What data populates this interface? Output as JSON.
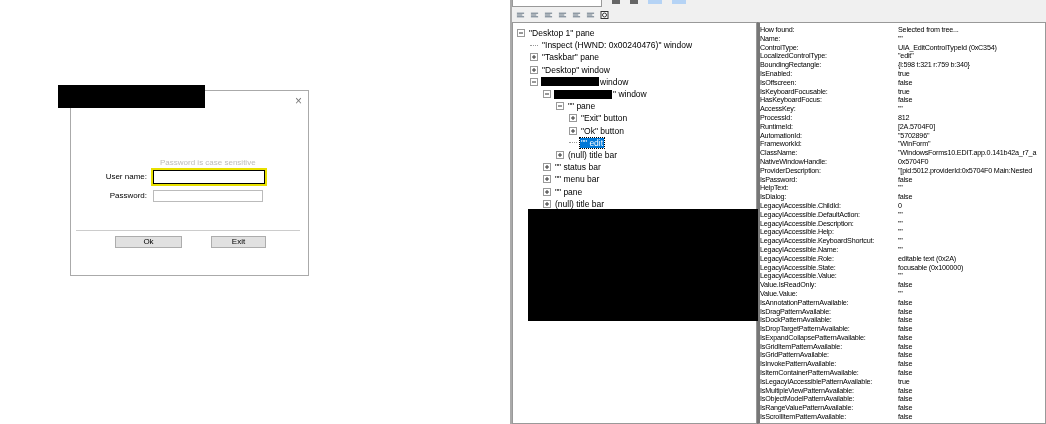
{
  "login_dialog": {
    "title_redacted": true,
    "close": "×",
    "hint": "Password is case sensitive",
    "fields": [
      {
        "label": "User name:",
        "focused": true
      },
      {
        "label": "Password:",
        "focused": false
      }
    ],
    "buttons": [
      "Ok",
      "Exit"
    ]
  },
  "inspect": {
    "tree": {
      "redacted_block": true,
      "items": [
        {
          "label": "\"Desktop 1\" pane",
          "expanded": true,
          "selected": false,
          "children": [
            {
              "label": "\"Inspect  (HWND: 0x00240476)\" window",
              "selected": false
            },
            {
              "label": "\"Taskbar\" pane",
              "expanded": false,
              "selected": false
            },
            {
              "label": "\"Desktop\" window",
              "expanded": false,
              "selected": false
            },
            {
              "label": "window",
              "redacted_prefix": true,
              "expanded": true,
              "selected": false,
              "children": [
                {
                  "label": "\" window",
                  "redacted_prefix": true,
                  "expanded": true,
                  "selected": false,
                  "children": [
                    {
                      "label": "\"\" pane",
                      "expanded": true,
                      "selected": false,
                      "children": [
                        {
                          "label": "\"Exit\" button",
                          "expanded": false,
                          "selected": false
                        },
                        {
                          "label": "\"Ok\" button",
                          "expanded": false,
                          "selected": false
                        },
                        {
                          "label": "\"\" edit",
                          "selected": true
                        }
                      ]
                    },
                    {
                      "label": "(null) title bar",
                      "expanded": false,
                      "selected": false
                    }
                  ]
                },
                {
                  "label": "\"\" status bar",
                  "expanded": false,
                  "selected": false
                },
                {
                  "label": "\"\" menu bar",
                  "expanded": false,
                  "selected": false
                },
                {
                  "label": "\"\" pane",
                  "expanded": false,
                  "selected": false
                },
                {
                  "label": "(null) title bar",
                  "expanded": false,
                  "selected": false
                }
              ]
            }
          ]
        }
      ]
    },
    "properties": [
      {
        "name": "How found:",
        "value": "Selected from tree..."
      },
      {
        "name": "Name:",
        "value": "\"\""
      },
      {
        "name": "ControlType:",
        "value": "UIA_EditControlTypeId (0xC354)"
      },
      {
        "name": "LocalizedControlType:",
        "value": "\"edit\""
      },
      {
        "name": "BoundingRectangle:",
        "value": "{l:598 t:321 r:759 b:340}"
      },
      {
        "name": "IsEnabled:",
        "value": "true"
      },
      {
        "name": "IsOffscreen:",
        "value": "false"
      },
      {
        "name": "IsKeyboardFocusable:",
        "value": "true"
      },
      {
        "name": "HasKeyboardFocus:",
        "value": "false"
      },
      {
        "name": "AccessKey:",
        "value": "\"\""
      },
      {
        "name": "ProcessId:",
        "value": "812"
      },
      {
        "name": "RuntimeId:",
        "value": "[2A.5704F0]"
      },
      {
        "name": "AutomationId:",
        "value": "\"5702896\""
      },
      {
        "name": "FrameworkId:",
        "value": "\"WinForm\""
      },
      {
        "name": "ClassName:",
        "value": "\"WindowsForms10.EDIT.app.0.141b42a_r7_a"
      },
      {
        "name": "NativeWindowHandle:",
        "value": "0x5704F0"
      },
      {
        "name": "ProviderDescription:",
        "value": "\"[pid:5012.providerId:0x5704F0 Main:Nested"
      },
      {
        "name": "IsPassword:",
        "value": "false"
      },
      {
        "name": "HelpText:",
        "value": "\"\""
      },
      {
        "name": "IsDialog:",
        "value": "false"
      },
      {
        "name": "LegacyIAccessible.ChildId:",
        "value": "0"
      },
      {
        "name": "LegacyIAccessible.DefaultAction:",
        "value": "\"\""
      },
      {
        "name": "LegacyIAccessible.Description:",
        "value": "\"\""
      },
      {
        "name": "LegacyIAccessible.Help:",
        "value": "\"\""
      },
      {
        "name": "LegacyIAccessible.KeyboardShortcut:",
        "value": "\"\""
      },
      {
        "name": "LegacyIAccessible.Name:",
        "value": "\"\""
      },
      {
        "name": "LegacyIAccessible.Role:",
        "value": "editable text (0x2A)"
      },
      {
        "name": "LegacyIAccessible.State:",
        "value": "focusable (0x100000)"
      },
      {
        "name": "LegacyIAccessible.Value:",
        "value": "\"\""
      },
      {
        "name": "Value.IsReadOnly:",
        "value": "false"
      },
      {
        "name": "Value.Value:",
        "value": "\"\""
      },
      {
        "name": "IsAnnotationPatternAvailable:",
        "value": "false"
      },
      {
        "name": "IsDragPatternAvailable:",
        "value": "false"
      },
      {
        "name": "IsDockPatternAvailable:",
        "value": "false"
      },
      {
        "name": "IsDropTargetPatternAvailable:",
        "value": "false"
      },
      {
        "name": "IsExpandCollapsePatternAvailable:",
        "value": "false"
      },
      {
        "name": "IsGridItemPatternAvailable:",
        "value": "false"
      },
      {
        "name": "IsGridPatternAvailable:",
        "value": "false"
      },
      {
        "name": "IsInvokePatternAvailable:",
        "value": "false"
      },
      {
        "name": "IsItemContainerPatternAvailable:",
        "value": "false"
      },
      {
        "name": "IsLegacyIAccessiblePatternAvailable:",
        "value": "true"
      },
      {
        "name": "IsMultipleViewPatternAvailable:",
        "value": "false"
      },
      {
        "name": "IsObjectModelPatternAvailable:",
        "value": "false"
      },
      {
        "name": "IsRangeValuePatternAvailable:",
        "value": "false"
      },
      {
        "name": "IsScrollItemPatternAvailable:",
        "value": "false"
      }
    ]
  }
}
